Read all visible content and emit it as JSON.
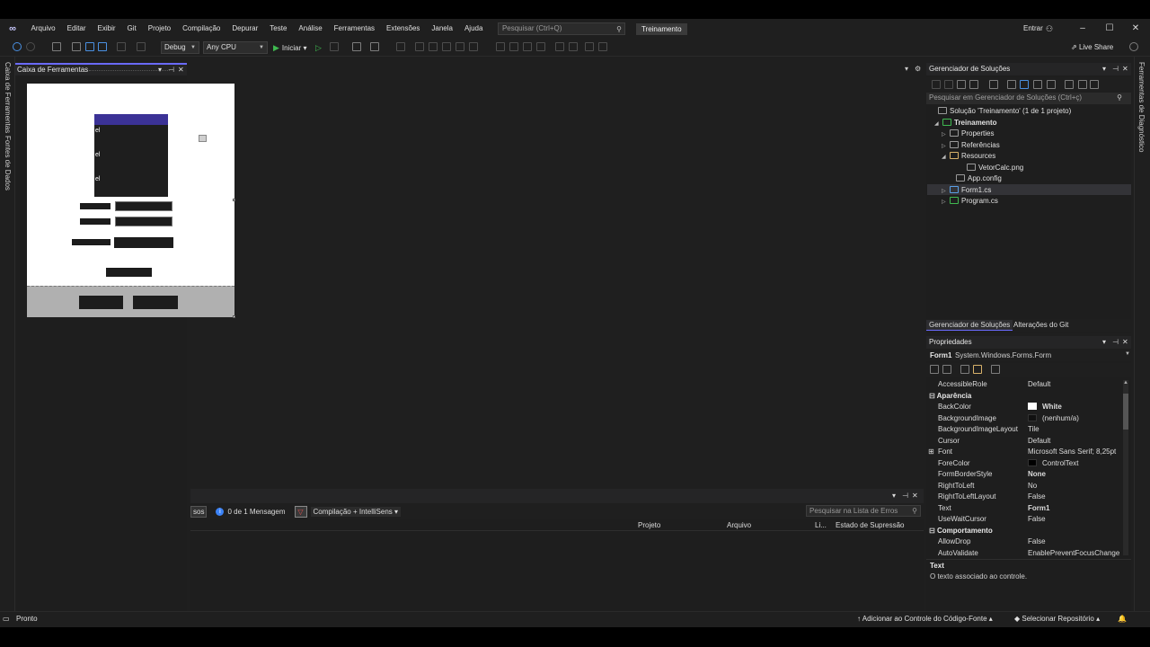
{
  "menu": {
    "items": [
      "Arquivo",
      "Editar",
      "Exibir",
      "Git",
      "Projeto",
      "Compilação",
      "Depurar",
      "Teste",
      "Análise",
      "Ferramentas",
      "Extensões",
      "Janela",
      "Ajuda"
    ],
    "search_placeholder": "Pesquisar (Ctrl+Q)",
    "solution_name": "Treinamento",
    "login": "Entrar"
  },
  "toolbar": {
    "config": "Debug",
    "platform": "Any CPU",
    "start_label": "Iniciar",
    "live_share": "Live Share"
  },
  "left_rail": {
    "tabs": [
      "Caixa de Ferramentas",
      "Fontes de Dados"
    ]
  },
  "right_rail": {
    "tabs": [
      "Ferramentas de Diagnóstico"
    ]
  },
  "toolbox": {
    "title": "Caixa de Ferramentas"
  },
  "designer": {
    "listbox_items": [
      "el",
      "el",
      "el"
    ]
  },
  "error_list": {
    "fragment": "sos",
    "messages": "0 de 1 Mensagem",
    "build_filter": "Compilação + IntelliSens",
    "search_placeholder": "Pesquisar na Lista de Erros",
    "columns": [
      "Projeto",
      "Arquivo",
      "Li...",
      "Estado de Supressão"
    ]
  },
  "solution_explorer": {
    "title": "Gerenciador de Soluções",
    "search_placeholder": "Pesquisar em Gerenciador de Soluções (Ctrl+ç)",
    "tree": [
      {
        "label": "Solução 'Treinamento' (1 de 1 projeto)",
        "arrow": ""
      },
      {
        "label": "Treinamento",
        "arrow": "◢"
      },
      {
        "label": "Properties",
        "arrow": "▷"
      },
      {
        "label": "Referências",
        "arrow": "▷"
      },
      {
        "label": "Resources",
        "arrow": "◢"
      },
      {
        "label": "VetorCalc.png",
        "arrow": ""
      },
      {
        "label": "App.config",
        "arrow": ""
      },
      {
        "label": "Form1.cs",
        "arrow": "▷"
      },
      {
        "label": "Program.cs",
        "arrow": "▷"
      }
    ],
    "tabs": [
      "Gerenciador de Soluções",
      "Alterações do Git"
    ]
  },
  "properties": {
    "title": "Propriedades",
    "object_name": "Form1",
    "object_type": "System.Windows.Forms.Form",
    "rows": [
      {
        "name": "AccessibleRole",
        "value": "Default"
      },
      {
        "category": "Aparência"
      },
      {
        "name": "BackColor",
        "value": "White",
        "swatch": "#ffffff",
        "bold": true
      },
      {
        "name": "BackgroundImage",
        "value": "(nenhum/a)",
        "swatch": "#111111"
      },
      {
        "name": "BackgroundImageLayout",
        "value": "Tile"
      },
      {
        "name": "Cursor",
        "value": "Default"
      },
      {
        "name": "Font",
        "value": "Microsoft Sans Serif; 8,25pt",
        "expand": true
      },
      {
        "name": "ForeColor",
        "value": "ControlText",
        "swatch": "#000000"
      },
      {
        "name": "FormBorderStyle",
        "value": "None",
        "bold": true
      },
      {
        "name": "RightToLeft",
        "value": "No"
      },
      {
        "name": "RightToLeftLayout",
        "value": "False"
      },
      {
        "name": "Text",
        "value": "Form1",
        "bold": true
      },
      {
        "name": "UseWaitCursor",
        "value": "False"
      },
      {
        "category": "Comportamento"
      },
      {
        "name": "AllowDrop",
        "value": "False"
      },
      {
        "name": "AutoValidate",
        "value": "EnablePreventFocusChange"
      }
    ],
    "desc_title": "Text",
    "desc_body": "O texto associado ao controle."
  },
  "status": {
    "ready": "Pronto",
    "source_control": "Adicionar ao Controle do Código-Fonte",
    "repo": "Selecionar Repositório"
  }
}
